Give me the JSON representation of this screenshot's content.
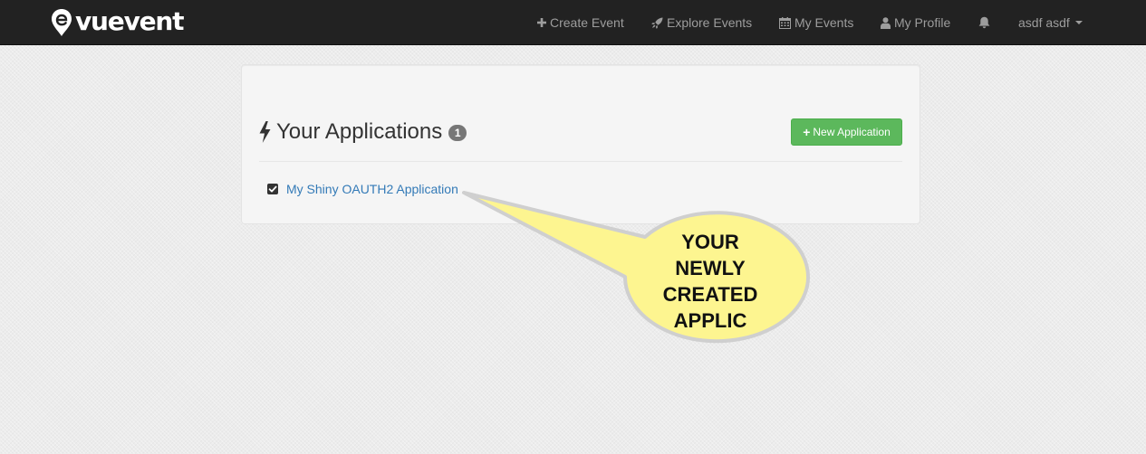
{
  "navbar": {
    "brand": "vuevent",
    "items": [
      {
        "label": "Create Event",
        "icon": "plus-icon"
      },
      {
        "label": "Explore Events",
        "icon": "rocket-icon"
      },
      {
        "label": "My Events",
        "icon": "calendar-icon"
      },
      {
        "label": "My Profile",
        "icon": "user-icon"
      }
    ],
    "notifications_icon": "bell-icon",
    "user": "asdf asdf"
  },
  "applications": {
    "heading": "Your Applications",
    "count": "1",
    "new_button": "New Application",
    "items": [
      {
        "name": "My Shiny OAUTH2 Application",
        "checked": true
      }
    ]
  },
  "callout": {
    "lines": [
      "YOUR",
      "NEWLY",
      "CREATED",
      "APPLIC"
    ],
    "fill_color": "#fdf590"
  },
  "colors": {
    "navbar_bg": "#222222",
    "nav_text": "#9d9d9d",
    "success_button": "#5cb85c",
    "link": "#337ab7",
    "badge": "#777777"
  }
}
